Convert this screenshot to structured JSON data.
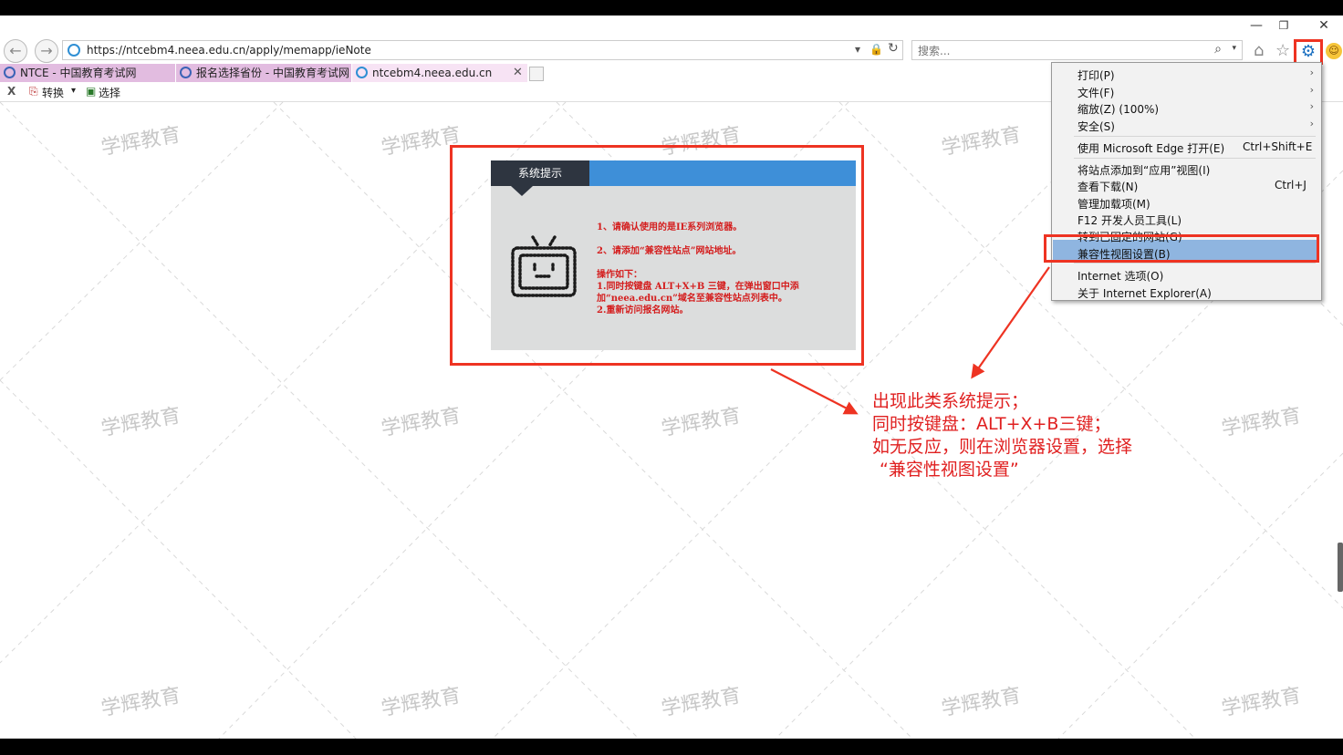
{
  "window": {
    "minimize": "—",
    "restore": "❐",
    "close": "✕"
  },
  "nav": {
    "back_icon": "back-arrow",
    "forward_icon": "forward-arrow"
  },
  "address_bar": {
    "url": "https://ntcebm4.neea.edu.cn/apply/memapp/ieNote",
    "dropdown": "▾",
    "lock": "🔒",
    "refresh": "↻"
  },
  "search": {
    "placeholder": "搜索...",
    "icon": "⌕",
    "dropdown": "▾"
  },
  "toolbar": {
    "home": "⌂",
    "favorites": "☆",
    "tools": "⚙",
    "feedback": "☺"
  },
  "tabs": [
    {
      "label": "NTCE - 中国教育考试网"
    },
    {
      "label": "报名选择省份 - 中国教育考试网"
    },
    {
      "label": "ntcebm4.neea.edu.cn",
      "close": "✕"
    }
  ],
  "command_bar": {
    "close": "X",
    "convert": "转换",
    "convert_dropdown": "▾",
    "select": "选择"
  },
  "watermark": {
    "text": "学辉教育"
  },
  "notice": {
    "header": "系统提示",
    "line1": "1、请确认使用的是IE系列浏览器。",
    "line2": "2、请添加“兼容性站点”网站地址。",
    "line3": "操作如下：",
    "line4": "1.同时按键盘 ALT+X+B 三键，在弹出窗口中添",
    "line5": "加“neea.edu.cn”域名至兼容性站点列表中。",
    "line6": "2.重新访问报名网站。"
  },
  "annotation": {
    "line1": "出现此类系统提示；",
    "line2": "同时按键盘：ALT+X+B三键；",
    "line3": "如无反应，则在浏览器设置，选择",
    "line4": "“兼容性视图设置”",
    "color": "#e02020"
  },
  "tools_menu": {
    "items": [
      {
        "label": "打印(P)",
        "arrow": "›"
      },
      {
        "label": "文件(F)",
        "arrow": "›"
      },
      {
        "label": "缩放(Z) (100%)",
        "arrow": "›"
      },
      {
        "label": "安全(S)",
        "arrow": "›"
      },
      {
        "label": "使用 Microsoft Edge 打开(E)",
        "shortcut": "Ctrl+Shift+E"
      },
      {
        "label": "将站点添加到“应用”视图(I)"
      },
      {
        "label": "查看下载(N)",
        "shortcut": "Ctrl+J"
      },
      {
        "label": "管理加载项(M)"
      },
      {
        "label": "F12 开发人员工具(L)"
      },
      {
        "label": "转到已固定的网站(G)"
      },
      {
        "label": "兼容性视图设置(B)",
        "highlighted": true
      },
      {
        "label": "Internet 选项(O)"
      },
      {
        "label": "关于 Internet Explorer(A)"
      }
    ]
  },
  "colors": {
    "highlight_red": "#e32",
    "notice_header_blue": "#3e8fd8",
    "notice_header_dark": "#2e3540",
    "notice_text_red": "#d41d1d"
  }
}
